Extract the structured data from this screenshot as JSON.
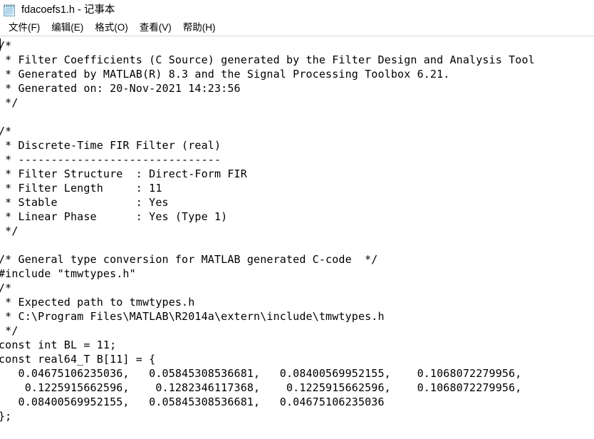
{
  "window": {
    "icon": "notepad-icon",
    "document_name": "fdacoefs1.h",
    "app_name": "记事本",
    "title": "fdacoefs1.h - 记事本"
  },
  "menu": {
    "items": [
      {
        "label": "文件(F)",
        "name": "file"
      },
      {
        "label": "编辑(E)",
        "name": "edit"
      },
      {
        "label": "格式(O)",
        "name": "format"
      },
      {
        "label": "查看(V)",
        "name": "view"
      },
      {
        "label": "帮助(H)",
        "name": "help"
      }
    ]
  },
  "editor": {
    "header_comment": {
      "open": "/*",
      "line1": " * Filter Coefficients (C Source) generated by the Filter Design and Analysis Tool",
      "line2": " * Generated by MATLAB(R) 8.3 and the Signal Processing Toolbox 6.21.",
      "line3": " * Generated on: 20-Nov-2021 14:23:56",
      "close": " */"
    },
    "filter_block": {
      "open": "/*",
      "title": " * Discrete-Time FIR Filter (real)",
      "rule": " * -------------------------------",
      "rows": [
        {
          "label": " * Filter Structure",
          "sep": ":",
          "value": "Direct-Form FIR"
        },
        {
          "label": " * Filter Length",
          "sep": ":",
          "value": "11"
        },
        {
          "label": " * Stable",
          "sep": ":",
          "value": "Yes"
        },
        {
          "label": " * Linear Phase",
          "sep": ":",
          "value": "Yes (Type 1)"
        }
      ],
      "close": " */"
    },
    "include_block": {
      "comment": "/* General type conversion for MATLAB generated C-code  */",
      "include": "#include \"tmwtypes.h\"",
      "open": "/*",
      "path_label": " * Expected path to tmwtypes.h",
      "path_value": " * C:\\Program Files\\MATLAB\\R2014a\\extern\\include\\tmwtypes.h",
      "close": " */"
    },
    "coefficients": {
      "bl_decl": "const int BL = 11;",
      "b_decl": "const real64_T B[11] = {",
      "values": [
        "0.04675106235036",
        "0.05845308536681",
        "0.08400569952155",
        "0.1068072279956",
        "0.1225915662596",
        "0.1282346117368",
        "0.1225915662596",
        "0.1068072279956",
        "0.08400569952155",
        "0.05845308536681",
        "0.04675106235036"
      ],
      "terminator": "};"
    },
    "full_text": "/*\n * Filter Coefficients (C Source) generated by the Filter Design and Analysis Tool\n * Generated by MATLAB(R) 8.3 and the Signal Processing Toolbox 6.21.\n * Generated on: 20-Nov-2021 14:23:56\n */\n\n/*\n * Discrete-Time FIR Filter (real)\n * -------------------------------\n * Filter Structure  : Direct-Form FIR\n * Filter Length     : 11\n * Stable            : Yes\n * Linear Phase      : Yes (Type 1)\n */\n\n/* General type conversion for MATLAB generated C-code  */\n#include \"tmwtypes.h\"\n/*\n * Expected path to tmwtypes.h\n * C:\\Program Files\\MATLAB\\R2014a\\extern\\include\\tmwtypes.h\n */\nconst int BL = 11;\nconst real64_T B[11] = {\n   0.04675106235036,   0.05845308536681,   0.08400569952155,    0.1068072279956,\n    0.1225915662596,    0.1282346117368,    0.1225915662596,    0.1068072279956,\n   0.08400569952155,   0.05845308536681,   0.04675106235036\n};"
  }
}
